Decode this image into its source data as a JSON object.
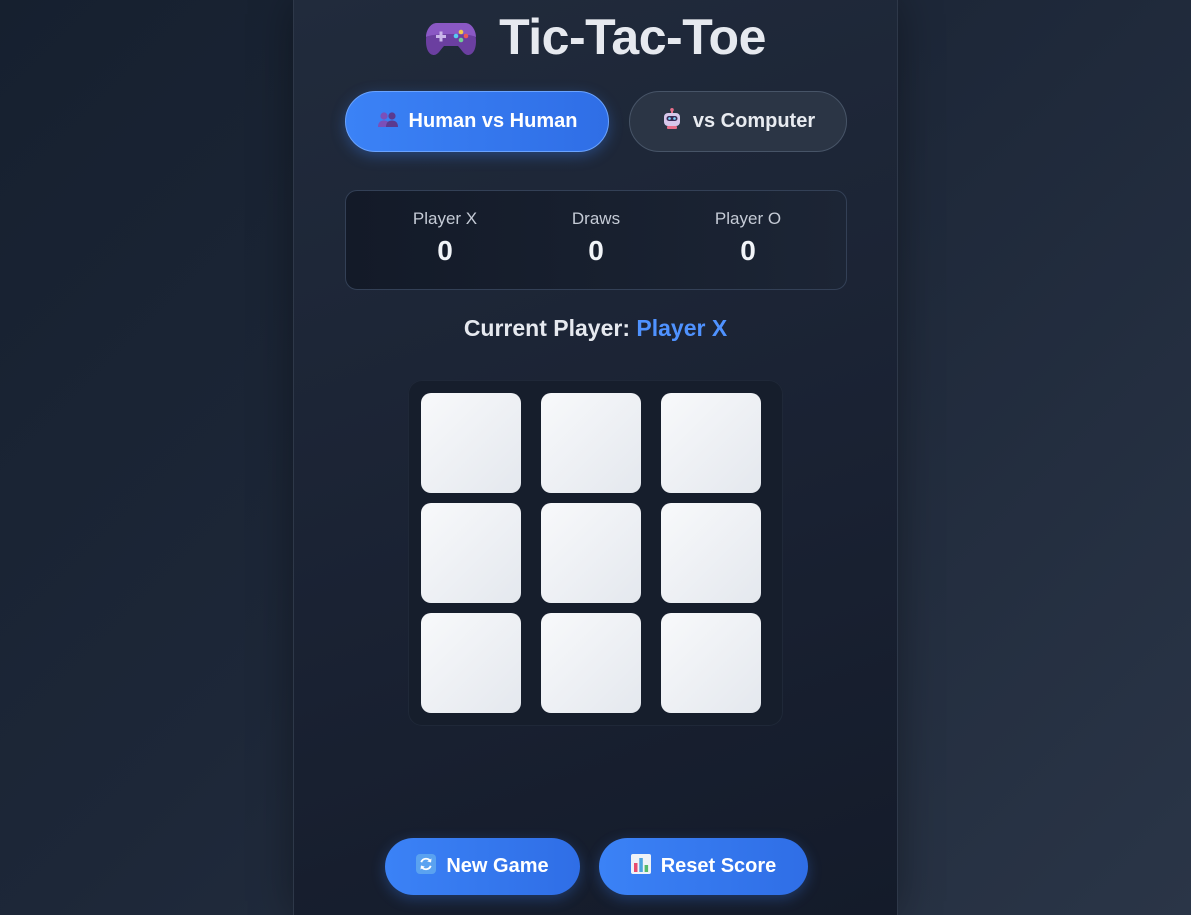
{
  "header": {
    "title": "Tic-Tac-Toe",
    "icon": "game-controller-icon"
  },
  "modes": [
    {
      "label": "Human vs Human",
      "icon": "two-people-icon",
      "active": true
    },
    {
      "label": "vs Computer",
      "icon": "robot-icon",
      "active": false
    }
  ],
  "scoreboard": {
    "x_label": "Player X",
    "x_value": "0",
    "draws_label": "Draws",
    "draws_value": "0",
    "o_label": "Player O",
    "o_value": "0"
  },
  "status": {
    "prefix": "Current Player:",
    "player": "Player X"
  },
  "board": {
    "cells": [
      "",
      "",
      "",
      "",
      "",
      "",
      "",
      "",
      ""
    ]
  },
  "actions": {
    "new_game_label": "New Game",
    "new_game_icon": "refresh-icon",
    "reset_label": "Reset Score",
    "reset_icon": "bar-chart-icon"
  },
  "colors": {
    "accent": "#3b82f6",
    "current_player": "#4f92ff",
    "background": "#1a2233"
  }
}
